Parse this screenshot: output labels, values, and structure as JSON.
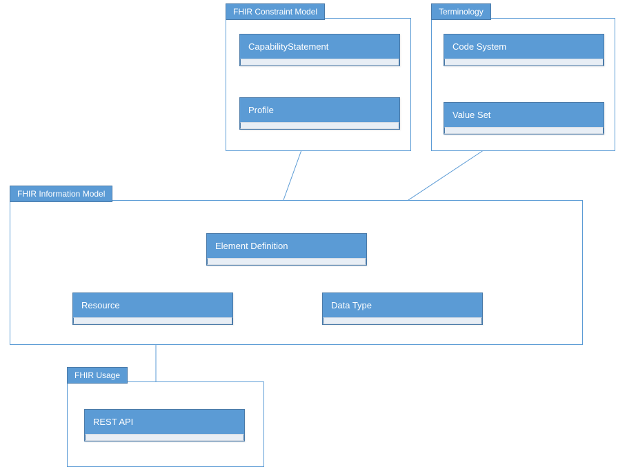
{
  "packages": {
    "constraint": {
      "label": "FHIR Constraint Model"
    },
    "terminology": {
      "label": "Terminology"
    },
    "information": {
      "label": "FHIR Information Model"
    },
    "usage": {
      "label": "FHIR Usage"
    }
  },
  "classes": {
    "capabilityStatement": {
      "name": "CapabilityStatement"
    },
    "profile": {
      "name": "Profile"
    },
    "codeSystem": {
      "name": "Code System"
    },
    "valueSet": {
      "name": "Value Set"
    },
    "elementDefinition": {
      "name": "Element Definition"
    },
    "resource": {
      "name": "Resource"
    },
    "dataType": {
      "name": "Data Type"
    },
    "restApi": {
      "name": "REST API"
    }
  }
}
